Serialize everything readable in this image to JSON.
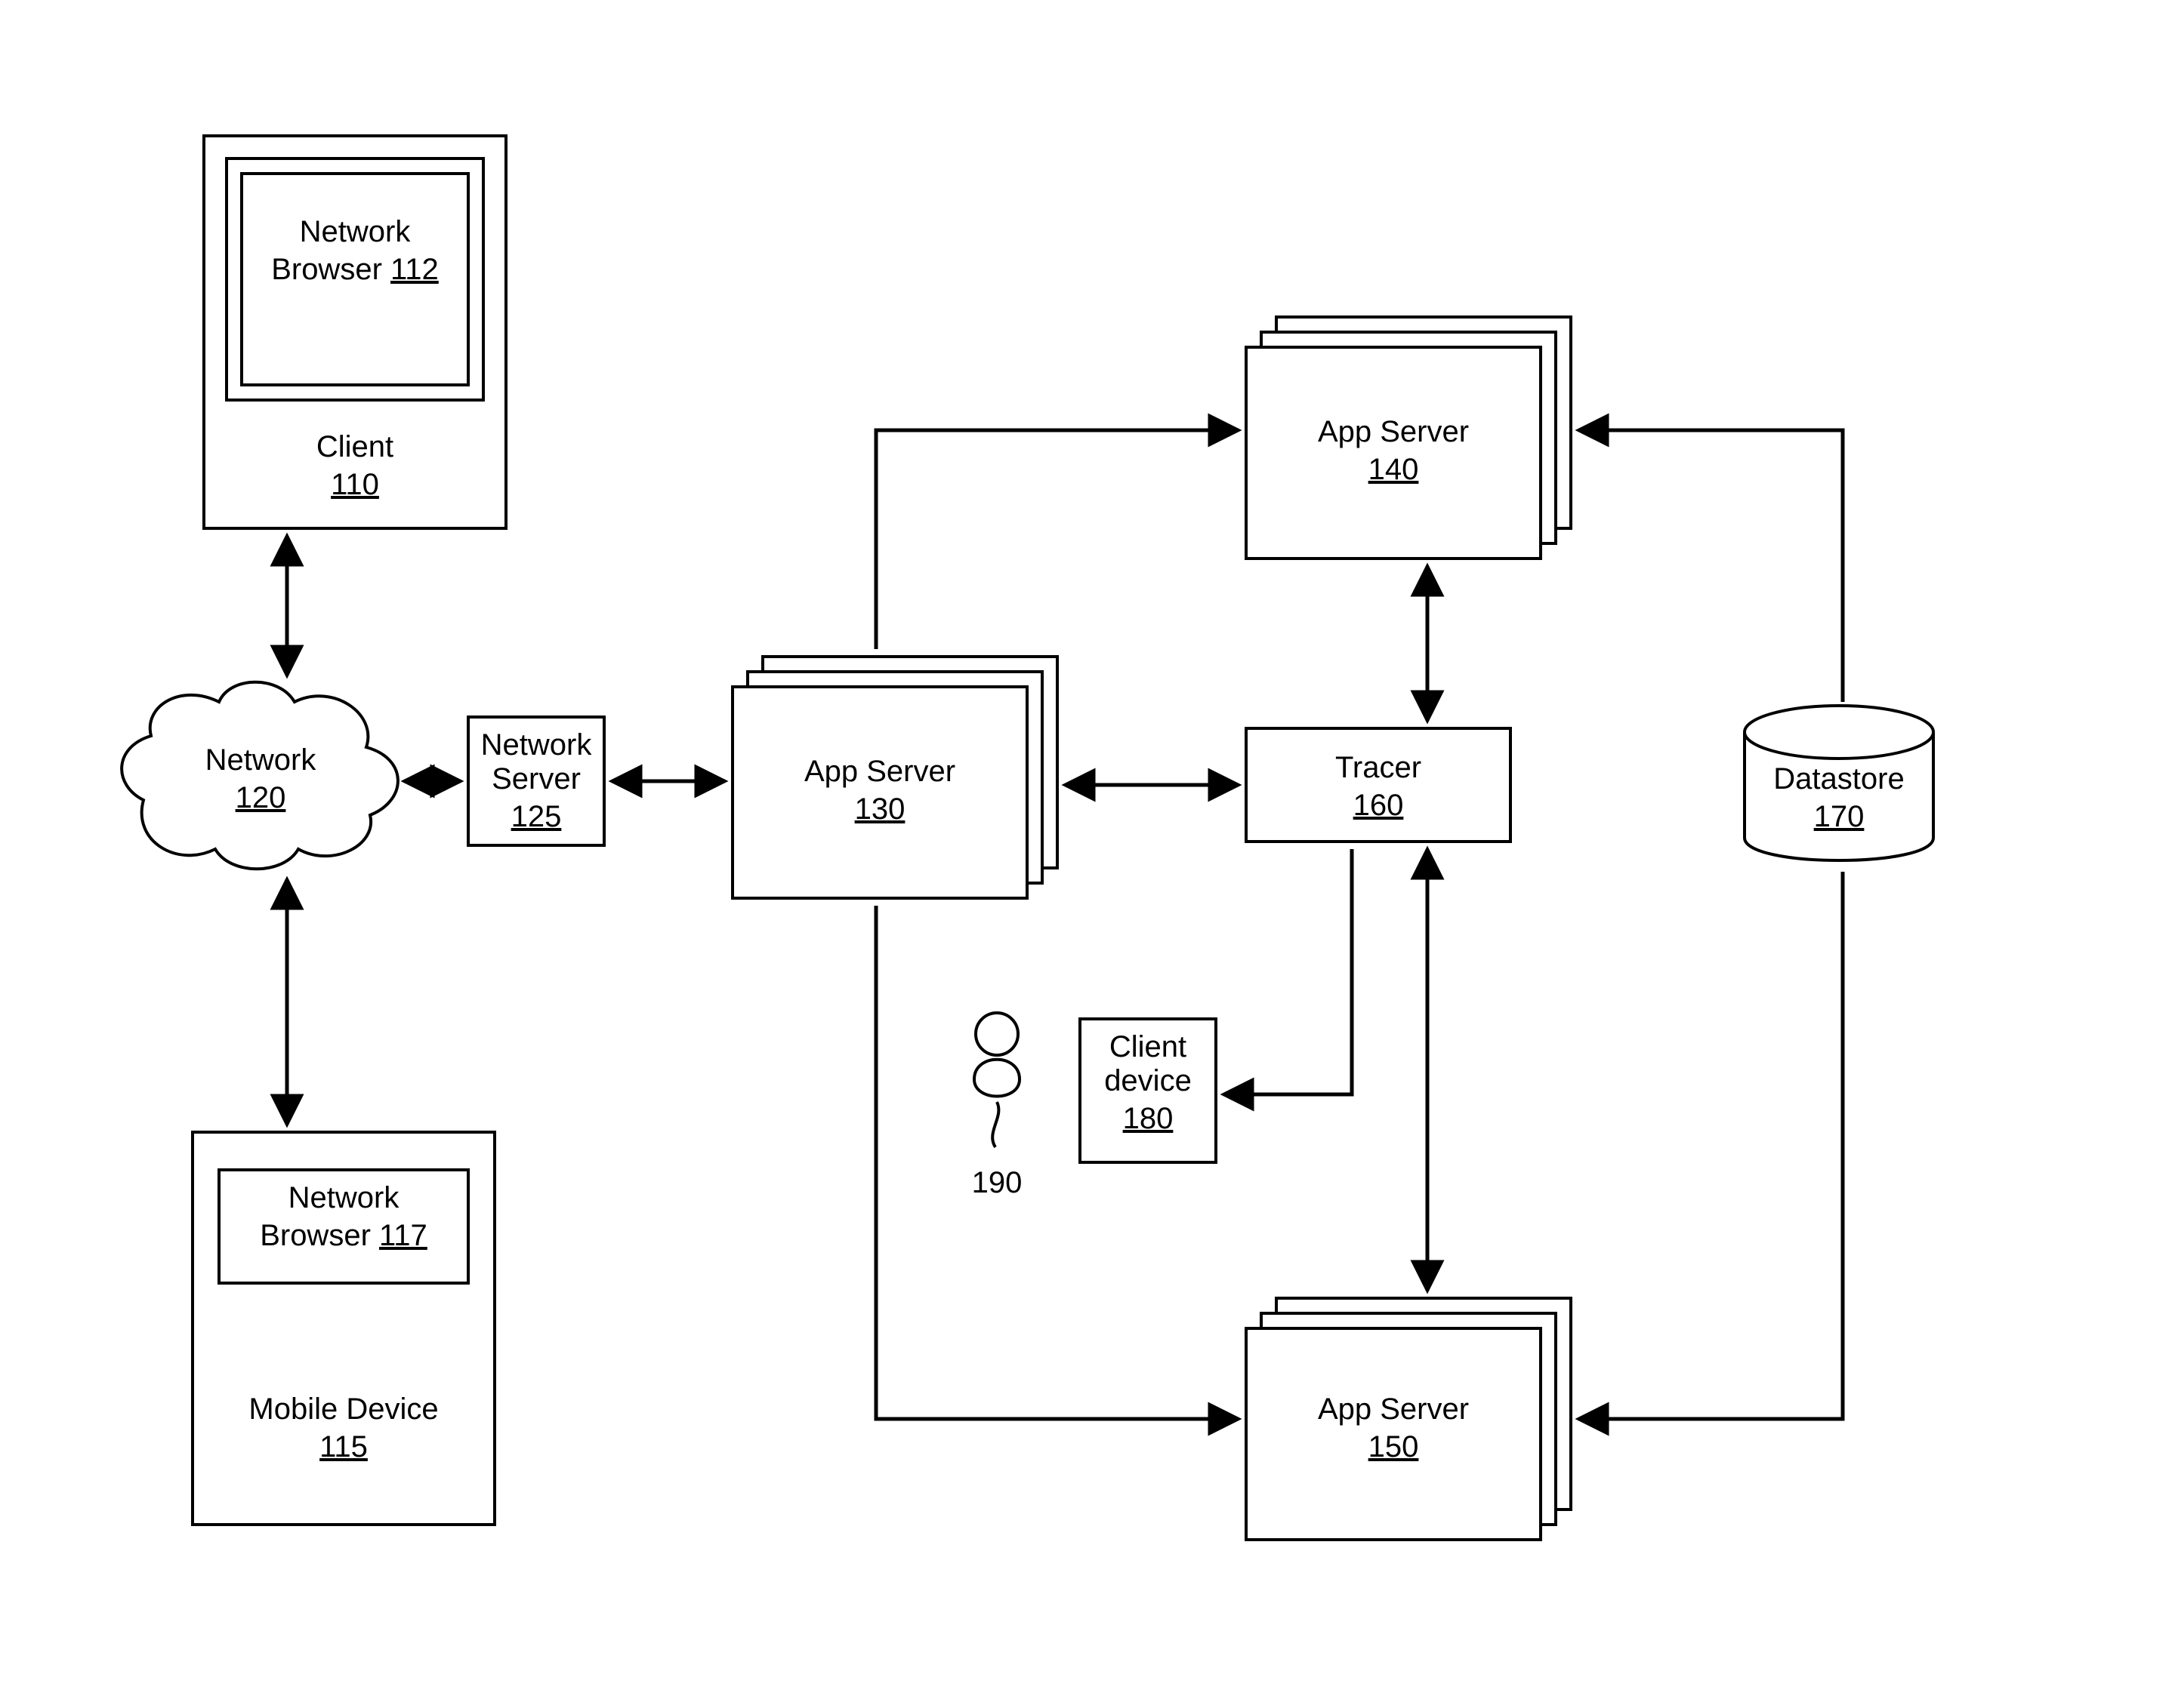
{
  "nodes": {
    "client": {
      "label": "Client",
      "ref": "110"
    },
    "netBrowser1": {
      "label1": "Network",
      "label2": "Browser",
      "ref": "112"
    },
    "network": {
      "label": "Network",
      "ref": "120"
    },
    "netServer": {
      "label1": "Network",
      "label2": "Server",
      "ref": "125"
    },
    "mobile": {
      "label": "Mobile Device",
      "ref": "115"
    },
    "netBrowser2": {
      "label1": "Network",
      "label2": "Browser",
      "ref": "117"
    },
    "app130": {
      "label": "App Server",
      "ref": "130"
    },
    "app140": {
      "label": "App Server",
      "ref": "140"
    },
    "app150": {
      "label": "App Server",
      "ref": "150"
    },
    "tracer": {
      "label": "Tracer",
      "ref": "160"
    },
    "datastore": {
      "label": "Datastore",
      "ref": "170"
    },
    "clientDevice": {
      "label1": "Client",
      "label2": "device",
      "ref": "180"
    },
    "user": {
      "ref": "190"
    }
  }
}
